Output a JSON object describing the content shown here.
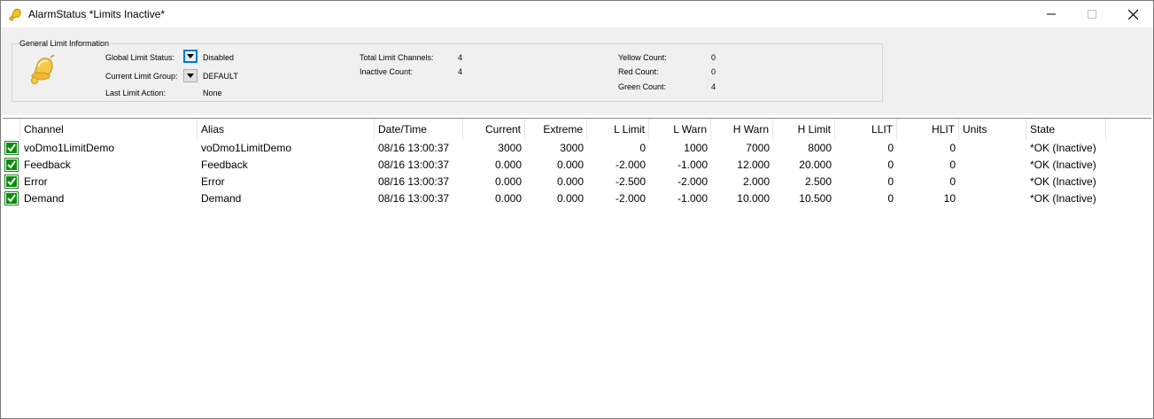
{
  "window": {
    "title": "AlarmStatus *Limits Inactive*",
    "icons": {
      "app": "bell-icon",
      "minimize": "minimize-icon",
      "maximize": "maximize-icon",
      "close": "close-icon"
    }
  },
  "info": {
    "group_title": "General Limit Information",
    "global_status_label": "Global Limit Status:",
    "global_status_value": "Disabled",
    "current_group_label": "Current Limit Group:",
    "current_group_value": "DEFAULT",
    "last_action_label": "Last Limit Action:",
    "last_action_value": "None",
    "total_channels_label": "Total Limit Channels:",
    "total_channels_value": "4",
    "inactive_count_label": "Inactive Count:",
    "inactive_count_value": "4",
    "yellow_count_label": "Yellow Count:",
    "yellow_count_value": "0",
    "red_count_label": "Red Count:",
    "red_count_value": "0",
    "green_count_label": "Green Count:",
    "green_count_value": "4"
  },
  "table": {
    "columns": [
      "Channel",
      "Alias",
      "Date/Time",
      "Current",
      "Extreme",
      "L Limit",
      "L Warn",
      "H Warn",
      "H Limit",
      "LLIT",
      "HLIT",
      "Units",
      "State"
    ],
    "rows": [
      [
        "voDmo1LimitDemo",
        "voDmo1LimitDemo",
        "08/16 13:00:37",
        "3000",
        "3000",
        "0",
        "1000",
        "7000",
        "8000",
        "0",
        "0",
        "",
        "*OK (Inactive)"
      ],
      [
        "Feedback",
        "Feedback",
        "08/16 13:00:37",
        "0.000",
        "0.000",
        "-2.000",
        "-1.000",
        "12.000",
        "20.000",
        "0",
        "0",
        "",
        "*OK (Inactive)"
      ],
      [
        "Error",
        "Error",
        "08/16 13:00:37",
        "0.000",
        "0.000",
        "-2.500",
        "-2.000",
        "2.000",
        "2.500",
        "0",
        "0",
        "",
        "*OK (Inactive)"
      ],
      [
        "Demand",
        "Demand",
        "08/16 13:00:37",
        "0.000",
        "0.000",
        "-2.000",
        "-1.000",
        "10.000",
        "10.500",
        "0",
        "10",
        "",
        "*OK (Inactive)"
      ]
    ],
    "row_icon": "green-check-icon"
  },
  "colors": {
    "check_green": "#0a8f0a",
    "panel_bg": "#f0f0f0",
    "focus_blue": "#0078d7"
  }
}
